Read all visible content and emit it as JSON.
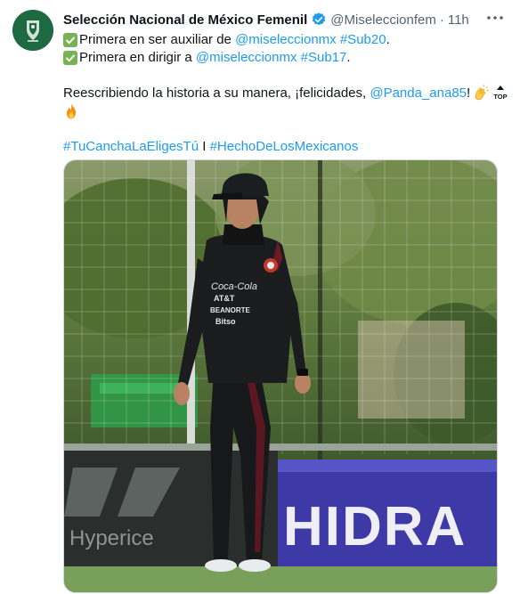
{
  "account": {
    "name": "Selección Nacional de México Femenil",
    "handle": "@Miseleccionfem",
    "separator": "·",
    "time": "11h"
  },
  "tweet": {
    "line1": {
      "text": "Primera en ser auxiliar de ",
      "mention": "@miseleccionmx",
      "hashtag": "#Sub20",
      "end": "."
    },
    "line2": {
      "text": "Primera en dirigir a ",
      "mention": "@miseleccionmx",
      "hashtag": "#Sub17",
      "end": "."
    },
    "line3": {
      "text": "Reescribiendo la historia a su manera, ¡felicidades, ",
      "mention": "@Panda_ana85",
      "end": "!"
    },
    "hashtag_a": "#TuCanchaLaEligesTú",
    "hashtag_sep": " I ",
    "hashtag_b": "#HechoDeLosMexicanos"
  },
  "photo": {
    "top_badge": "TOP",
    "jersey": {
      "sponsor1": "Coca-Cola",
      "sponsor2": "AT&T",
      "sponsor3": "BEANORTE",
      "sponsor4": "Bitso"
    },
    "banner_left": "Hyperice",
    "banner_right": "HIDRA"
  },
  "icons": {
    "verified": "verified-badge-icon",
    "more": "more-options-icon",
    "check": "check-mark-icon",
    "clap": "clapping-hands-icon",
    "top": "top-arrow-icon",
    "fire": "fire-icon"
  },
  "colors": {
    "link": "#1d9bf0",
    "secondary_text": "#536471",
    "check_green": "#77b255"
  }
}
